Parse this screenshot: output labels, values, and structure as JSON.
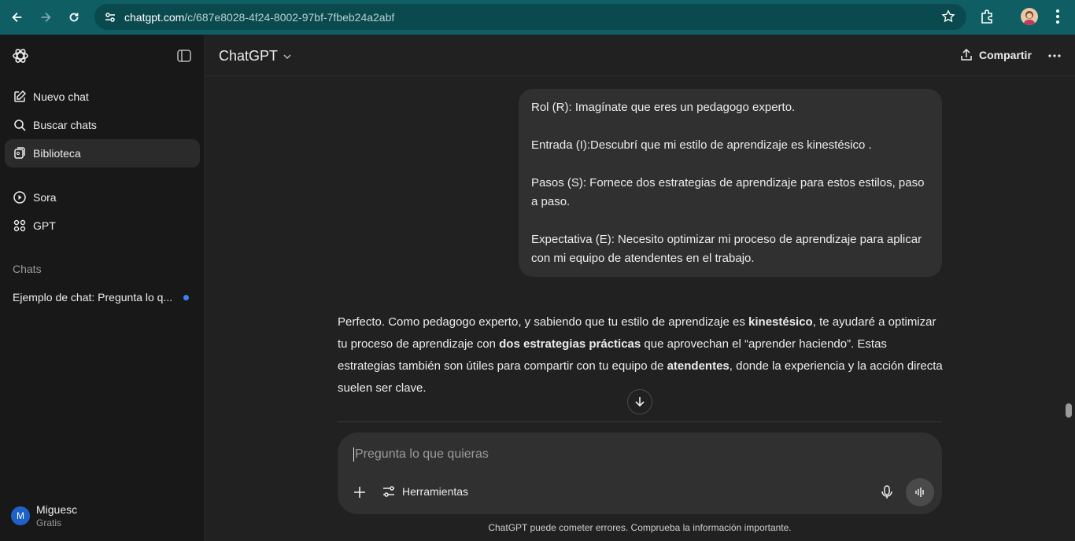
{
  "browser": {
    "url_domain": "chatgpt.com",
    "url_path": "/c/687e8028-4f24-8002-97bf-7fbeb24a2abf"
  },
  "sidebar": {
    "items": [
      {
        "label": "Nuevo chat",
        "icon": "edit-icon"
      },
      {
        "label": "Buscar chats",
        "icon": "search-icon"
      },
      {
        "label": "Biblioteca",
        "icon": "library-icon"
      },
      {
        "label": "Sora",
        "icon": "play-circle-icon"
      },
      {
        "label": "GPT",
        "icon": "grid-icon"
      }
    ],
    "chats_heading": "Chats",
    "chats": [
      {
        "title": "Ejemplo de chat: Pregunta lo q..."
      }
    ],
    "user": {
      "initial": "M",
      "name": "Miguesc",
      "plan": "Gratis"
    }
  },
  "header": {
    "model": "ChatGPT",
    "share_label": "Compartir"
  },
  "conversation": {
    "user_message": [
      "Rol (R): Imagínate que eres un pedagogo experto.",
      "Entrada (I):Descubrí que mi estilo de aprendizaje es kinestésico .",
      "Pasos (S): Fornece dos estrategias de aprendizaje para estos estilos, paso a paso.",
      "Expectativa (E): Necesito optimizar mi proceso de aprendizaje para aplicar con mi equipo de atendentes en el trabajo."
    ],
    "assistant": {
      "t1": "Perfecto. Como pedagogo experto, y sabiendo que tu estilo de aprendizaje es ",
      "b1": "kinestésico",
      "t2": ", te ayudaré a optimizar tu proceso de aprendizaje con ",
      "b2": "dos estrategias prácticas",
      "t3": " que aprovechan el “aprender haciendo”. Estas estrategias también son útiles para compartir con tu equipo de ",
      "b3": "atendentes",
      "t4": ", donde la experiencia y la acción directa suelen ser clave."
    }
  },
  "composer": {
    "placeholder": "Pregunta lo que quieras",
    "tools_label": "Herramientas"
  },
  "disclaimer": "ChatGPT puede cometer errores. Comprueba la información importante."
}
